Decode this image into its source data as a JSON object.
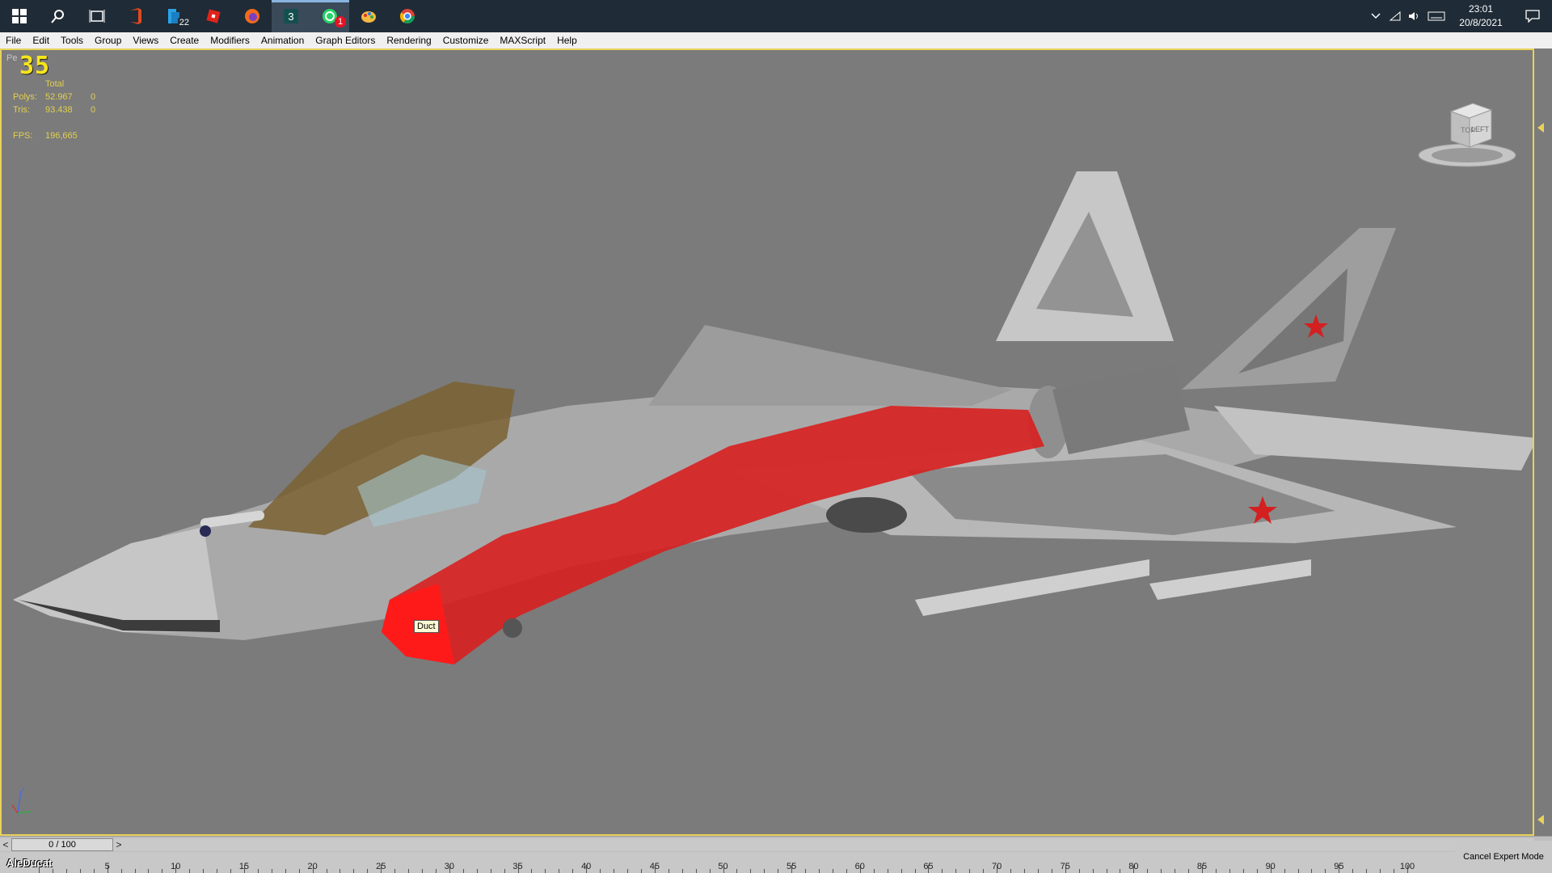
{
  "taskbar": {
    "apps": [
      {
        "name": "windows-start-icon",
        "badge": ""
      },
      {
        "name": "search-icon",
        "badge": ""
      },
      {
        "name": "task-view-icon",
        "badge": ""
      },
      {
        "name": "office-icon",
        "badge": ""
      },
      {
        "name": "folder-icon",
        "badge": "22"
      },
      {
        "name": "roblox-icon",
        "badge": ""
      },
      {
        "name": "firefox-icon",
        "badge": ""
      },
      {
        "name": "3dsmax-icon",
        "badge": ""
      },
      {
        "name": "whatsapp-icon",
        "badge": "1"
      },
      {
        "name": "paint-icon",
        "badge": ""
      },
      {
        "name": "chrome-icon",
        "badge": ""
      }
    ],
    "time": "23:01",
    "date": "20/8/2021"
  },
  "menu": [
    "File",
    "Edit",
    "Tools",
    "Group",
    "Views",
    "Create",
    "Modifiers",
    "Animation",
    "Graph Editors",
    "Rendering",
    "Customize",
    "MAXScript",
    "Help"
  ],
  "viewport": {
    "label": "Pe",
    "fps_big": "35",
    "stats": {
      "header": "Total",
      "polys_label": "Polys:",
      "polys_value": "52.967",
      "polys_sel": "0",
      "tris_label": "Tris:",
      "tris_value": "93.438",
      "tris_sel": "0",
      "fps_label": "FPS:",
      "fps_value": "196,665"
    },
    "viewcube_top": "TOP",
    "viewcube_face": "LEFT",
    "tooltip": "Duct"
  },
  "timeslider": {
    "frame_text": "0 / 100",
    "prev": "<",
    "next": ">"
  },
  "trackbar": {
    "ticks": [
      5,
      10,
      15,
      20,
      25,
      30,
      35,
      40,
      45,
      50,
      55,
      60,
      65,
      70,
      75,
      80,
      85,
      90,
      95,
      100
    ]
  },
  "status": {
    "expert_button": "Cancel Expert Mode",
    "user_label": "AleDucat"
  },
  "colors": {
    "viewport_bg": "#7b7b7b",
    "viewport_border": "#e8d25a",
    "stats_text": "#e2cf4e",
    "fps_big": "#f7e51b",
    "duct": "#d81f1f"
  }
}
